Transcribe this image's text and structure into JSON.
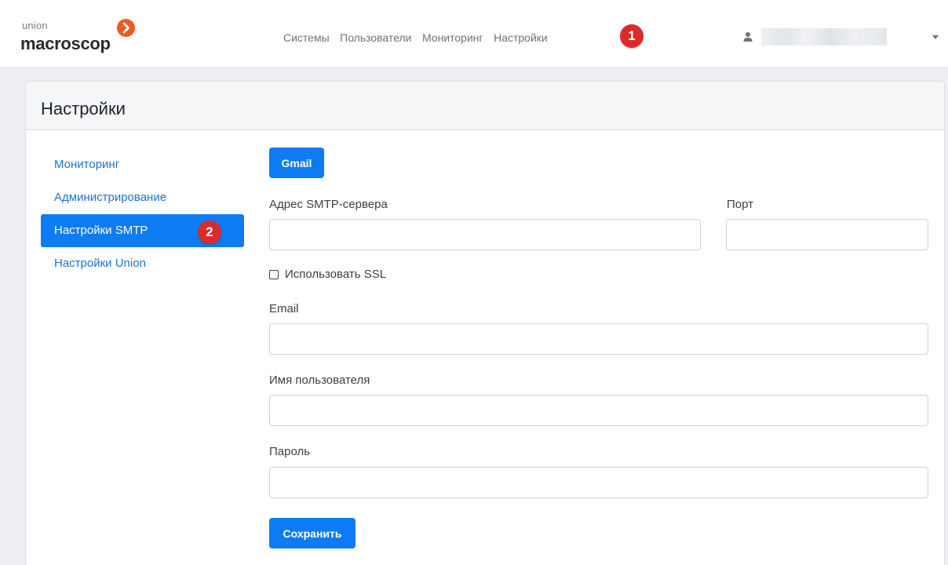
{
  "brand": {
    "small": "union",
    "name": "macroscop",
    "mark_color": "#ef5a24"
  },
  "nav": {
    "items": [
      {
        "label": "Системы"
      },
      {
        "label": "Пользователи"
      },
      {
        "label": "Мониторинг"
      },
      {
        "label": "Настройки"
      }
    ],
    "user_icon": "user-icon",
    "caret_icon": "caret-down-icon"
  },
  "badges": {
    "one": "1",
    "two": "2",
    "color": "#dc2a2a"
  },
  "page": {
    "title": "Настройки"
  },
  "sidebar": {
    "items": [
      {
        "label": "Мониторинг",
        "active": false
      },
      {
        "label": "Администрирование",
        "active": false
      },
      {
        "label": "Настройки SMTP",
        "active": true
      },
      {
        "label": "Настройки Union",
        "active": false
      }
    ],
    "active_color": "#0d7cf2",
    "link_color": "#1a73d0"
  },
  "form": {
    "gmail_button": "Gmail",
    "smtp_server_label": "Адрес SMTP-сервера",
    "smtp_server_value": "",
    "port_label": "Порт",
    "port_value": "",
    "ssl_label": "Использовать SSL",
    "ssl_checked": false,
    "email_label": "Email",
    "email_value": "",
    "username_label": "Имя пользователя",
    "username_value": "",
    "password_label": "Пароль",
    "password_value": "",
    "save_button": "Сохранить"
  }
}
